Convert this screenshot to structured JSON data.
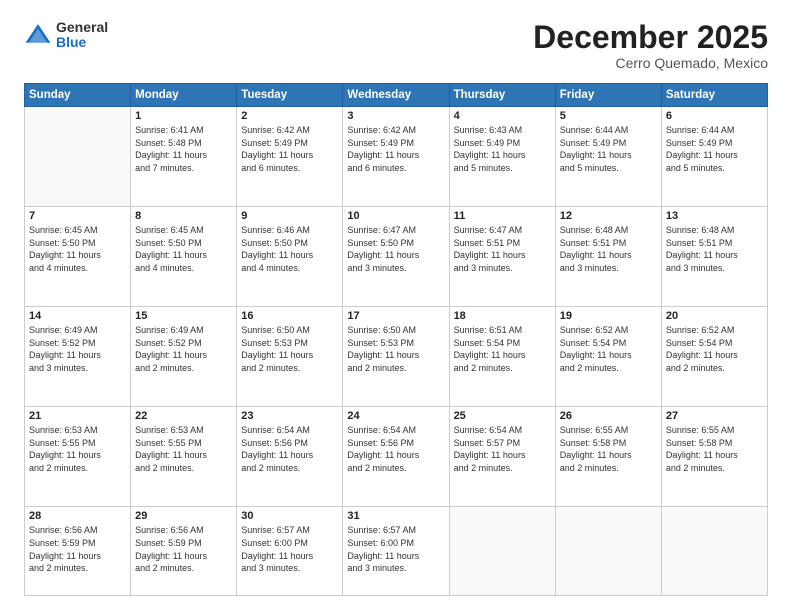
{
  "header": {
    "logo": {
      "general": "General",
      "blue": "Blue"
    },
    "title": "December 2025",
    "location": "Cerro Quemado, Mexico"
  },
  "weekdays": [
    "Sunday",
    "Monday",
    "Tuesday",
    "Wednesday",
    "Thursday",
    "Friday",
    "Saturday"
  ],
  "weeks": [
    [
      {
        "day": "",
        "info": ""
      },
      {
        "day": "1",
        "info": "Sunrise: 6:41 AM\nSunset: 5:48 PM\nDaylight: 11 hours\nand 7 minutes."
      },
      {
        "day": "2",
        "info": "Sunrise: 6:42 AM\nSunset: 5:49 PM\nDaylight: 11 hours\nand 6 minutes."
      },
      {
        "day": "3",
        "info": "Sunrise: 6:42 AM\nSunset: 5:49 PM\nDaylight: 11 hours\nand 6 minutes."
      },
      {
        "day": "4",
        "info": "Sunrise: 6:43 AM\nSunset: 5:49 PM\nDaylight: 11 hours\nand 5 minutes."
      },
      {
        "day": "5",
        "info": "Sunrise: 6:44 AM\nSunset: 5:49 PM\nDaylight: 11 hours\nand 5 minutes."
      },
      {
        "day": "6",
        "info": "Sunrise: 6:44 AM\nSunset: 5:49 PM\nDaylight: 11 hours\nand 5 minutes."
      }
    ],
    [
      {
        "day": "7",
        "info": "Sunrise: 6:45 AM\nSunset: 5:50 PM\nDaylight: 11 hours\nand 4 minutes."
      },
      {
        "day": "8",
        "info": "Sunrise: 6:45 AM\nSunset: 5:50 PM\nDaylight: 11 hours\nand 4 minutes."
      },
      {
        "day": "9",
        "info": "Sunrise: 6:46 AM\nSunset: 5:50 PM\nDaylight: 11 hours\nand 4 minutes."
      },
      {
        "day": "10",
        "info": "Sunrise: 6:47 AM\nSunset: 5:50 PM\nDaylight: 11 hours\nand 3 minutes."
      },
      {
        "day": "11",
        "info": "Sunrise: 6:47 AM\nSunset: 5:51 PM\nDaylight: 11 hours\nand 3 minutes."
      },
      {
        "day": "12",
        "info": "Sunrise: 6:48 AM\nSunset: 5:51 PM\nDaylight: 11 hours\nand 3 minutes."
      },
      {
        "day": "13",
        "info": "Sunrise: 6:48 AM\nSunset: 5:51 PM\nDaylight: 11 hours\nand 3 minutes."
      }
    ],
    [
      {
        "day": "14",
        "info": "Sunrise: 6:49 AM\nSunset: 5:52 PM\nDaylight: 11 hours\nand 3 minutes."
      },
      {
        "day": "15",
        "info": "Sunrise: 6:49 AM\nSunset: 5:52 PM\nDaylight: 11 hours\nand 2 minutes."
      },
      {
        "day": "16",
        "info": "Sunrise: 6:50 AM\nSunset: 5:53 PM\nDaylight: 11 hours\nand 2 minutes."
      },
      {
        "day": "17",
        "info": "Sunrise: 6:50 AM\nSunset: 5:53 PM\nDaylight: 11 hours\nand 2 minutes."
      },
      {
        "day": "18",
        "info": "Sunrise: 6:51 AM\nSunset: 5:54 PM\nDaylight: 11 hours\nand 2 minutes."
      },
      {
        "day": "19",
        "info": "Sunrise: 6:52 AM\nSunset: 5:54 PM\nDaylight: 11 hours\nand 2 minutes."
      },
      {
        "day": "20",
        "info": "Sunrise: 6:52 AM\nSunset: 5:54 PM\nDaylight: 11 hours\nand 2 minutes."
      }
    ],
    [
      {
        "day": "21",
        "info": "Sunrise: 6:53 AM\nSunset: 5:55 PM\nDaylight: 11 hours\nand 2 minutes."
      },
      {
        "day": "22",
        "info": "Sunrise: 6:53 AM\nSunset: 5:55 PM\nDaylight: 11 hours\nand 2 minutes."
      },
      {
        "day": "23",
        "info": "Sunrise: 6:54 AM\nSunset: 5:56 PM\nDaylight: 11 hours\nand 2 minutes."
      },
      {
        "day": "24",
        "info": "Sunrise: 6:54 AM\nSunset: 5:56 PM\nDaylight: 11 hours\nand 2 minutes."
      },
      {
        "day": "25",
        "info": "Sunrise: 6:54 AM\nSunset: 5:57 PM\nDaylight: 11 hours\nand 2 minutes."
      },
      {
        "day": "26",
        "info": "Sunrise: 6:55 AM\nSunset: 5:58 PM\nDaylight: 11 hours\nand 2 minutes."
      },
      {
        "day": "27",
        "info": "Sunrise: 6:55 AM\nSunset: 5:58 PM\nDaylight: 11 hours\nand 2 minutes."
      }
    ],
    [
      {
        "day": "28",
        "info": "Sunrise: 6:56 AM\nSunset: 5:59 PM\nDaylight: 11 hours\nand 2 minutes."
      },
      {
        "day": "29",
        "info": "Sunrise: 6:56 AM\nSunset: 5:59 PM\nDaylight: 11 hours\nand 2 minutes."
      },
      {
        "day": "30",
        "info": "Sunrise: 6:57 AM\nSunset: 6:00 PM\nDaylight: 11 hours\nand 3 minutes."
      },
      {
        "day": "31",
        "info": "Sunrise: 6:57 AM\nSunset: 6:00 PM\nDaylight: 11 hours\nand 3 minutes."
      },
      {
        "day": "",
        "info": ""
      },
      {
        "day": "",
        "info": ""
      },
      {
        "day": "",
        "info": ""
      }
    ]
  ]
}
